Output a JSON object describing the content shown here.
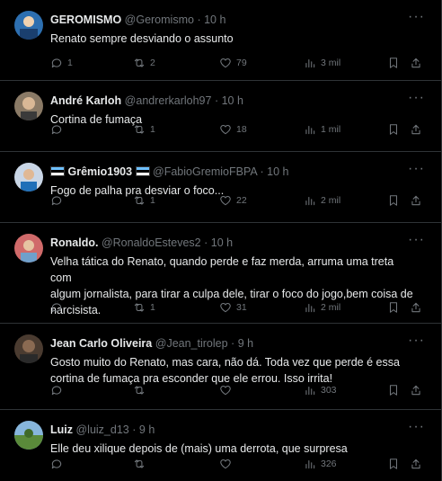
{
  "tweets": [
    {
      "name": "GEROMISMO",
      "handle": "@Geromismo",
      "dot": "·",
      "time": "10 h",
      "text": "Renato sempre desviando o assunto",
      "replies": "1",
      "retweets": "2",
      "likes": "79",
      "views": "3 mil",
      "avatar_color": "#2d6fb0"
    },
    {
      "name": "André Karloh",
      "handle": "@andrerkarloh97",
      "dot": "·",
      "time": "10 h",
      "text": "Cortina de fumaça",
      "replies": "",
      "retweets": "1",
      "likes": "18",
      "views": "1 mil",
      "avatar_color": "#8a7a66"
    },
    {
      "name": "Grêmio1903",
      "handle": "@FabioGremioFBPA",
      "dot": "·",
      "time": "10 h",
      "text": "Fogo de palha pra desviar o foco...",
      "replies": "",
      "retweets": "1",
      "likes": "22",
      "views": "2 mil",
      "avatar_color": "#c9d6e6"
    },
    {
      "name": "Ronaldo.",
      "handle": "@RonaldoEsteves2",
      "dot": "·",
      "time": "10 h",
      "text_lines": [
        "Velha tática do Renato, quando perde e faz merda, arruma uma treta com",
        "algum jornalista, para tirar a culpa dele, tirar o foco do jogo,bem coisa de",
        "narcisista."
      ],
      "replies": "",
      "retweets": "1",
      "likes": "31",
      "views": "2 mil",
      "avatar_color": "#d06a6a"
    },
    {
      "name": "Jean Carlo Oliveira",
      "handle": "@Jean_tirolep",
      "dot": "·",
      "time": "9 h",
      "text_lines": [
        "Gosto muito do Renato, mas cara, não dá. Toda vez que perde é essa",
        "cortina de fumaça pra esconder que ele errou. Isso irrita!"
      ],
      "replies": "",
      "retweets": "",
      "likes": "",
      "views": "303",
      "avatar_color": "#4a3b30"
    },
    {
      "name": "Luiz",
      "handle": "@luiz_d13",
      "dot": "·",
      "time": "9 h",
      "text": "Elle deu xilique depois de (mais) uma derrota, que surpresa",
      "replies": "",
      "retweets": "",
      "likes": "",
      "views": "326",
      "avatar_color": "#5a8a3a"
    }
  ],
  "icons": {
    "reply": "reply-icon",
    "retweet": "retweet-icon",
    "like": "heart-icon",
    "views": "views-icon",
    "bookmark": "bookmark-icon",
    "share": "share-icon",
    "more": "more-icon"
  },
  "more_glyph": "···"
}
